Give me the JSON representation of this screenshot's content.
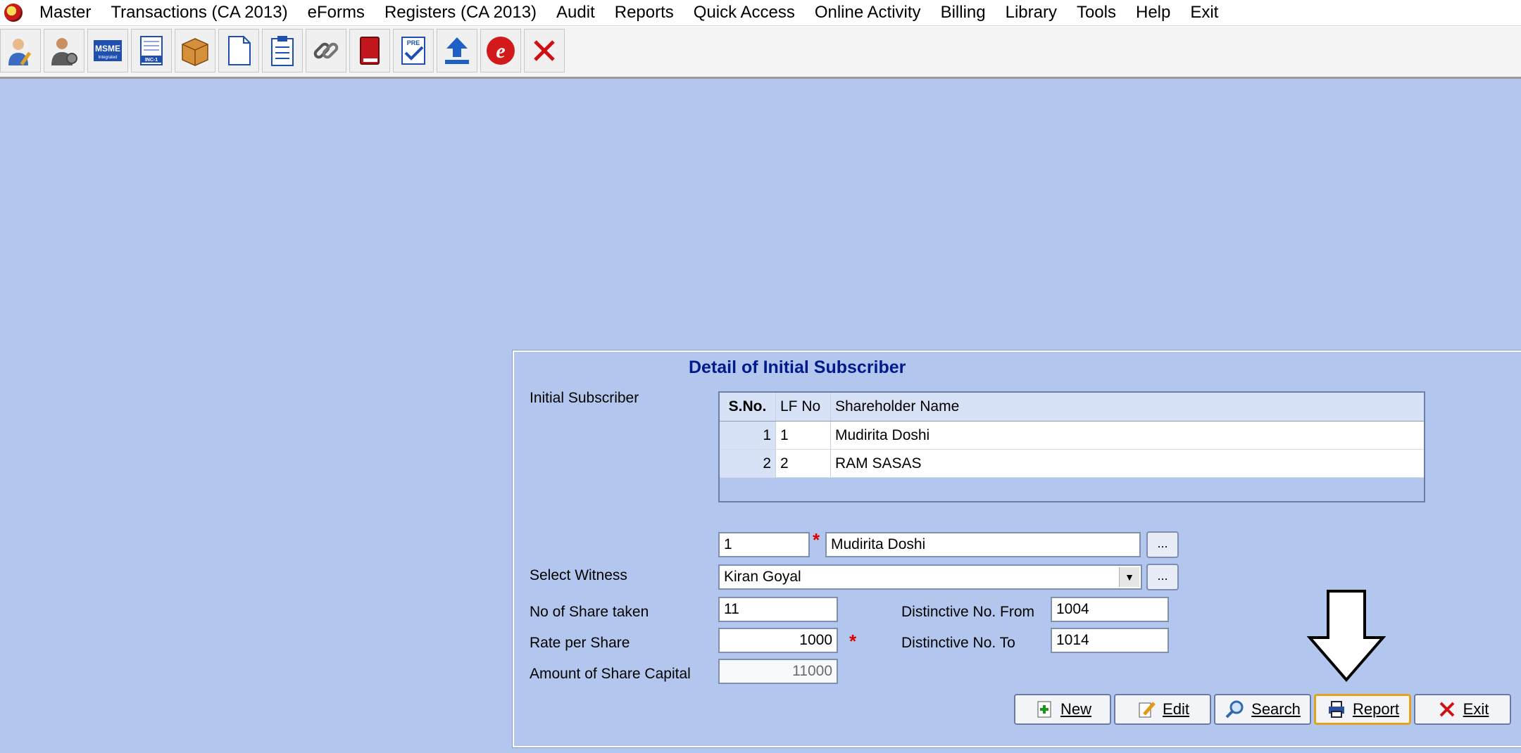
{
  "menu": [
    "Master",
    "Transactions (CA 2013)",
    "eForms",
    "Registers (CA 2013)",
    "Audit",
    "Reports",
    "Quick Access",
    "Online Activity",
    "Billing",
    "Library",
    "Tools",
    "Help",
    "Exit"
  ],
  "toolbar_icons": [
    "user-edit-icon",
    "user-settings-icon",
    "msme-icon",
    "inc-1-icon",
    "box-icon",
    "document-icon",
    "clipboard-icon",
    "link-icon",
    "book-icon",
    "pre-check-icon",
    "upload-icon",
    "e-icon",
    "close-icon"
  ],
  "toolbar_labels": {
    "msme": "MSME",
    "msme_sub": "Integrated",
    "inc": "INC-1",
    "pre": "PRE"
  },
  "panel": {
    "title": "Detail of Initial Subscriber",
    "initial_subscriber_label": "Initial Subscriber",
    "grid": {
      "headers": [
        "S.No.",
        "LF No",
        "Shareholder Name"
      ],
      "rows": [
        {
          "sno": "1",
          "lf": "1",
          "name": "Mudirita  Doshi"
        },
        {
          "sno": "2",
          "lf": "2",
          "name": "RAM  SASAS"
        }
      ]
    },
    "subscriber_no": "1",
    "subscriber_name": "Mudirita  Doshi",
    "ellipsis": "...",
    "witness_label": "Select Witness",
    "witness_value": "Kiran Goyal",
    "shares_label": "No of Share taken",
    "shares_value": "11",
    "rate_label": "Rate per Share",
    "rate_value": "1000",
    "amount_label": "Amount of Share Capital",
    "amount_value": "11000",
    "dist_from_label": "Distinctive No. From",
    "dist_from_value": "1004",
    "dist_to_label": "Distinctive No. To",
    "dist_to_value": "1014",
    "required_mark": "*"
  },
  "buttons": {
    "new": "New",
    "edit": "Edit",
    "search": "Search",
    "report": "Report",
    "exit": "Exit"
  },
  "colors": {
    "background": "#b3c7ee",
    "title": "#001a8c",
    "required": "#e00000",
    "active_border": "#e3a21a"
  }
}
